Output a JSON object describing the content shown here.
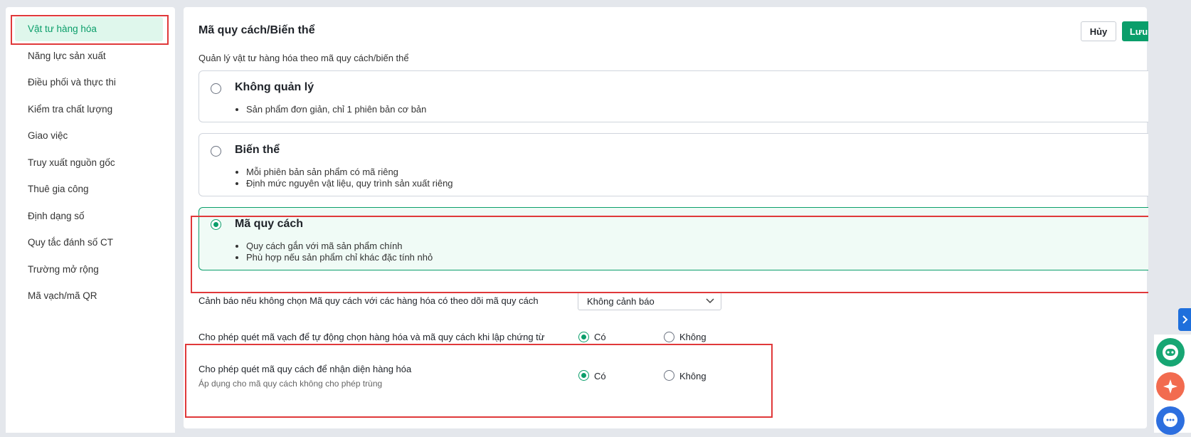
{
  "sidebar": {
    "items": [
      {
        "label": "Vật tư hàng hóa",
        "active": true
      },
      {
        "label": "Năng lực sản xuất"
      },
      {
        "label": "Điều phối và thực thi"
      },
      {
        "label": "Kiểm tra chất lượng"
      },
      {
        "label": "Giao việc"
      },
      {
        "label": "Truy xuất nguồn gốc"
      },
      {
        "label": "Thuê gia công"
      },
      {
        "label": "Định dạng số"
      },
      {
        "label": "Quy tắc đánh số CT"
      },
      {
        "label": "Trường mở rộng"
      },
      {
        "label": "Mã vạch/mã QR"
      }
    ]
  },
  "header": {
    "title": "Mã quy cách/Biến thể",
    "cancel_label": "Hủy",
    "save_label": "Lưu",
    "subtitle": "Quản lý vật tư hàng hóa theo mã quy cách/biến thể"
  },
  "options": [
    {
      "title": "Không quản lý",
      "bullets": [
        "Sản phẩm đơn giản, chỉ 1 phiên bản cơ bản"
      ],
      "selected": false
    },
    {
      "title": "Biến thể",
      "bullets": [
        "Mỗi phiên bản sản phẩm có mã riêng",
        "Định mức nguyên vật liệu, quy trình sản xuất riêng"
      ],
      "selected": false
    },
    {
      "title": "Mã quy cách",
      "bullets": [
        "Quy cách gắn với mã sản phẩm chính",
        "Phù hợp nếu sản phẩm chỉ khác đặc tính nhỏ"
      ],
      "selected": true
    }
  ],
  "warning": {
    "label": "Cảnh báo nếu không chọn Mã quy cách với các hàng hóa có theo dõi mã quy cách",
    "selected": "Không cảnh báo"
  },
  "settings": [
    {
      "label": "Cho phép quét mã vạch để tự động chọn hàng hóa và mã quy cách khi lập chứng từ",
      "yes": "Có",
      "no": "Không",
      "value": "yes"
    },
    {
      "label": "Cho phép quét mã quy cách để nhận diện hàng hóa",
      "note": "Áp dụng cho mã quy cách không cho phép trùng",
      "yes": "Có",
      "no": "Không",
      "value": "yes"
    }
  ],
  "colors": {
    "accent": "#0a9e6a",
    "highlight": "#e0393a",
    "tab_blue": "#1e6fdc",
    "chat_green": "#17a673",
    "ai_orange": "#f26b4f",
    "msg_blue": "#2d6fdf"
  },
  "icons": [
    "chevron-down-icon",
    "chevron-right-icon",
    "chatbot-icon",
    "sparkle-icon",
    "message-icon"
  ]
}
